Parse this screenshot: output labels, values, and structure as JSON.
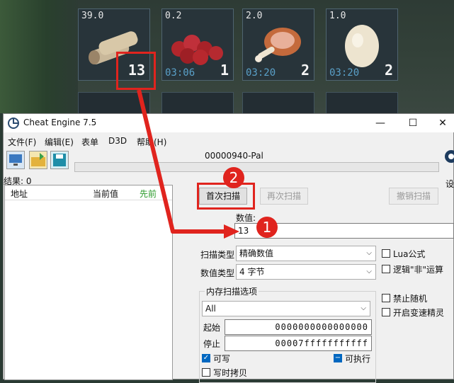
{
  "game": {
    "slots": [
      {
        "weight": "39.0",
        "count": "13",
        "time": "",
        "item_icon": "wood-icon"
      },
      {
        "weight": "0.2",
        "count": "1",
        "time": "03:06",
        "item_icon": "berries-icon"
      },
      {
        "weight": "2.0",
        "count": "2",
        "time": "03:20",
        "item_icon": "meat-icon"
      },
      {
        "weight": "1.0",
        "count": "2",
        "time": "03:20",
        "item_icon": "egg-icon"
      }
    ]
  },
  "window": {
    "title": "Cheat Engine 7.5",
    "minimize": "—",
    "maximize": "☐",
    "close": "✕",
    "menu": [
      "文件(F)",
      "编辑(E)",
      "表单",
      "D3D",
      "帮助(H)"
    ],
    "process": "00000940-Pal",
    "results_label": "结果: 0",
    "settings_label": "设",
    "columns": {
      "address": "地址",
      "current": "当前值",
      "previous": "先前"
    }
  },
  "scan": {
    "first_scan": "首次扫描",
    "next_scan": "再次扫描",
    "undo_scan": "撤销扫描",
    "value_label": "数值:",
    "value": "13",
    "scan_type_label": "扫描类型",
    "scan_type": "精确数值",
    "value_type_label": "数值类型",
    "value_type": "4 字节",
    "lua_formula": "Lua公式",
    "logical_not": "逻辑\"非\"运算",
    "memory_options_label": "内存扫描选项",
    "region": "All",
    "start_label": "起始",
    "start": "0000000000000000",
    "stop_label": "停止",
    "stop": "00007fffffffffff",
    "writable": "可写",
    "executable": "可执行",
    "copy_on_write": "写时拷贝",
    "no_random": "禁止随机",
    "speedhack": "开启变速精灵"
  },
  "annotations": {
    "step1": "1",
    "step2": "2"
  },
  "colors": {
    "annotation_red": "#e0241e",
    "checkbox_blue": "#0067c0"
  }
}
